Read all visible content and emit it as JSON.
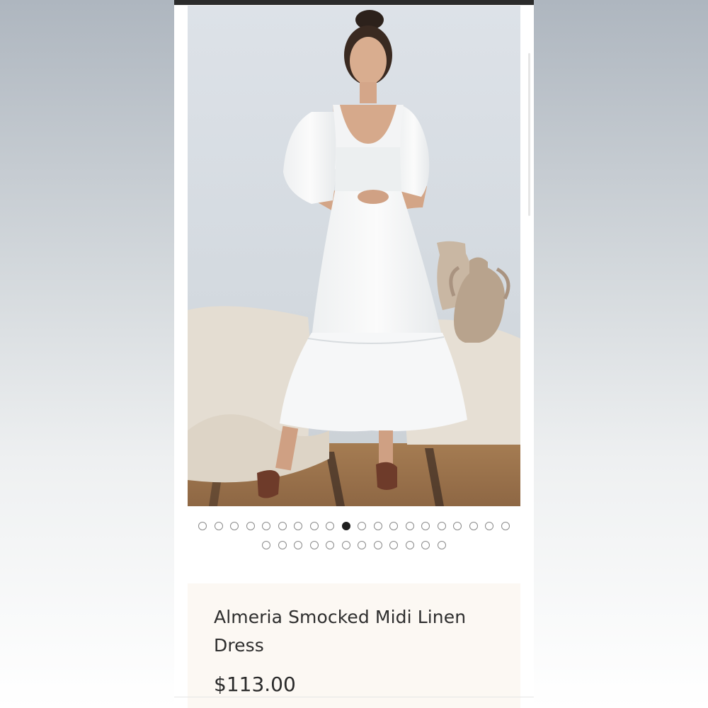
{
  "product": {
    "title": "Almeria Smocked Midi Linen Dress",
    "price": "$113.00"
  },
  "gallery": {
    "total_images": 32,
    "active_index": 9,
    "rows": [
      20,
      12
    ]
  },
  "colors": {
    "card_background": "#fcf8f3",
    "dot_active": "#1f1f1f",
    "dot_inactive_border": "#8a8a8a"
  },
  "icons": {
    "carousel_indicator": "circle-dot"
  }
}
